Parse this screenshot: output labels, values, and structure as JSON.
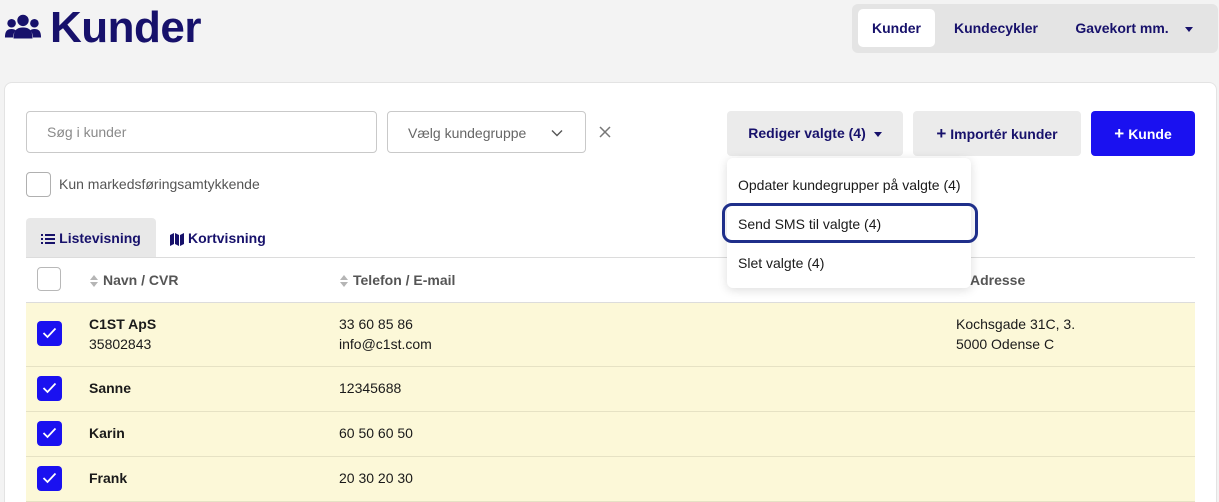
{
  "header": {
    "title": "Kunder",
    "title_icon": "users-icon"
  },
  "top_nav": {
    "items": [
      {
        "label": "Kunder",
        "active": true
      },
      {
        "label": "Kundecykler",
        "active": false
      },
      {
        "label": "Gavekort mm.",
        "active": false,
        "has_dropdown": true
      }
    ]
  },
  "toolbar": {
    "search_placeholder": "Søg i kunder",
    "group_select_label": "Vælg kundegruppe",
    "edit_selected_label": "Rediger valgte (4)",
    "import_label": "Importér kunder",
    "add_label": "Kunde",
    "marketing_filter_label": "Kun markedsføringsamtykkende"
  },
  "dropdown": {
    "items": [
      {
        "label": "Opdater kundegrupper på valgte (4)"
      },
      {
        "label": "Send SMS til valgte (4)",
        "highlighted": true
      },
      {
        "label": "Slet valgte (4)"
      }
    ]
  },
  "view_tabs": [
    {
      "label": "Listevisning",
      "icon": "list-icon",
      "active": true
    },
    {
      "label": "Kortvisning",
      "icon": "map-icon",
      "active": false
    }
  ],
  "table": {
    "columns": [
      "Navn / CVR",
      "Telefon / E-mail",
      "Adresse"
    ],
    "rows": [
      {
        "checked": true,
        "name": "C1ST ApS",
        "cvr": "35802843",
        "phone": "33 60 85 86",
        "email": "info@c1st.com",
        "address_line1": "Kochsgade 31C, 3.",
        "address_line2": "5000 Odense C"
      },
      {
        "checked": true,
        "name": "Sanne",
        "cvr": "",
        "phone": "12345688",
        "email": "",
        "address_line1": "",
        "address_line2": ""
      },
      {
        "checked": true,
        "name": "Karin",
        "cvr": "",
        "phone": "60 50 60 50",
        "email": "",
        "address_line1": "",
        "address_line2": ""
      },
      {
        "checked": true,
        "name": "Frank",
        "cvr": "",
        "phone": "20 30 20 30",
        "email": "",
        "address_line1": "",
        "address_line2": ""
      }
    ]
  },
  "colors": {
    "brand_navy": "#17116b",
    "primary_blue": "#1a11f0",
    "selected_row_bg": "#fcf8d8",
    "highlight_ring": "#1f2f8a"
  }
}
